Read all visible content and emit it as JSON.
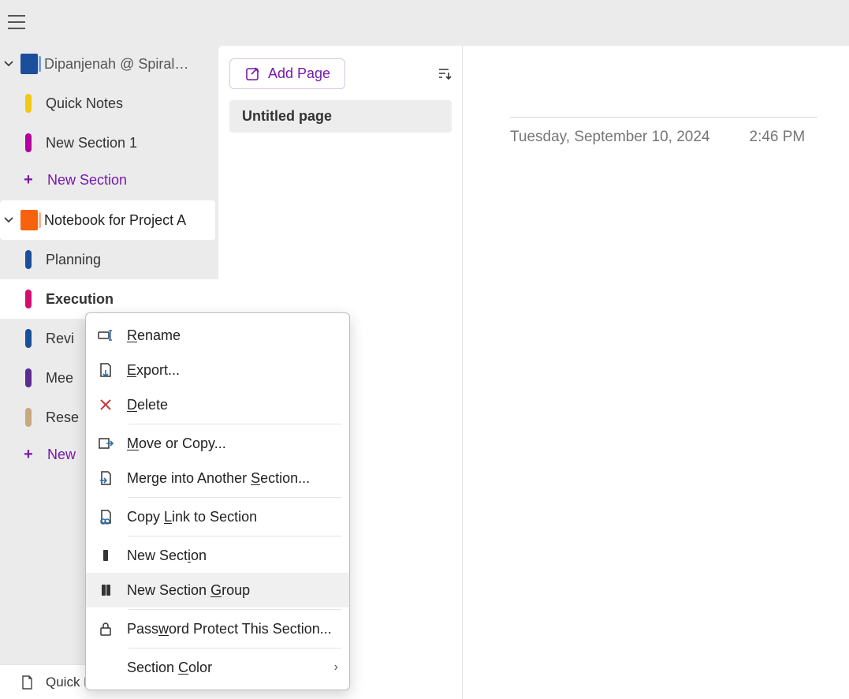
{
  "sidebar": {
    "notebooks": [
      {
        "name": "Dipanjenah @ Spiral…",
        "icon_color": "#1b4e9b",
        "expanded": true,
        "sections": [
          {
            "label": "Quick Notes",
            "color": "#f2c811"
          },
          {
            "label": "New Section 1",
            "color": "#b4009e"
          }
        ],
        "new_section_label": "New Section"
      },
      {
        "name": "Notebook for Project A",
        "icon_color": "#f7630c",
        "expanded": true,
        "selected": true,
        "sections": [
          {
            "label": "Planning",
            "color": "#1b4e9b"
          },
          {
            "label": "Execution",
            "color": "#d40e6f",
            "active": true
          },
          {
            "label": "Revi",
            "color": "#1b4e9b"
          },
          {
            "label": "Mee",
            "color": "#5b2d90"
          },
          {
            "label": "Rese",
            "color": "#c8a97e"
          }
        ],
        "new_section_label": "New"
      }
    ],
    "quick_notes_label": "Quick Notes"
  },
  "pages": {
    "add_label": "Add Page",
    "items": [
      {
        "title": "Untitled page",
        "selected": true
      }
    ]
  },
  "content": {
    "date": "Tuesday, September 10, 2024",
    "time": "2:46 PM"
  },
  "context_menu": {
    "items": [
      {
        "label_pre": "",
        "mn": "R",
        "label_post": "ename",
        "icon": "rename"
      },
      {
        "label_pre": "",
        "mn": "E",
        "label_post": "xport...",
        "icon": "export"
      },
      {
        "label_pre": "",
        "mn": "D",
        "label_post": "elete",
        "icon": "delete"
      },
      {
        "label_pre": "",
        "mn": "M",
        "label_post": "ove or Copy...",
        "icon": "move",
        "sep_before": true
      },
      {
        "label_pre": "Merge into Another ",
        "mn": "S",
        "label_post": "ection...",
        "icon": "merge"
      },
      {
        "label_pre": "Copy ",
        "mn": "L",
        "label_post": "ink to Section",
        "icon": "link",
        "sep_before": true
      },
      {
        "label_pre": "New Sect",
        "mn": "i",
        "label_post": "on",
        "icon": "section",
        "sep_before": true
      },
      {
        "label_pre": "New Section ",
        "mn": "G",
        "label_post": "roup",
        "icon": "group",
        "hover": true
      },
      {
        "label_pre": "Pass",
        "mn": "w",
        "label_post": "ord Protect This Section...",
        "icon": "lock",
        "sep_before": true
      },
      {
        "label_pre": "Section ",
        "mn": "C",
        "label_post": "olor",
        "icon": "",
        "sep_before": true,
        "submenu": true
      }
    ]
  }
}
